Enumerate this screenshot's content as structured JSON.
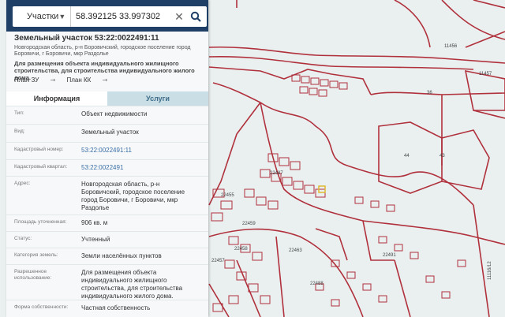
{
  "search": {
    "type_label": "Участки",
    "query": "58.392125 33.997302"
  },
  "parcel": {
    "title": "Земельный участок 53:22:0022491:11",
    "address_sub": "Новгородская область, р-н Боровичский, городское поселение город Боровичи, г Боровичи, мкр Раздолье",
    "purpose": "Для размещения объекта индивидуального жилищного строительства, для строительства индивидуального жилого дома.",
    "plan_links": [
      "План ЗУ",
      "План КК"
    ]
  },
  "tabs": [
    {
      "label": "Информация",
      "active": true
    },
    {
      "label": "Услуги",
      "active": false
    }
  ],
  "info_rows": [
    {
      "label": "Тип:",
      "value": "Объект недвижимости"
    },
    {
      "label": "Вид:",
      "value": "Земельный участок"
    },
    {
      "label": "Кадастровый номер:",
      "value": "53:22:0022491:11",
      "link": true
    },
    {
      "label": "Кадастровый квартал:",
      "value": "53:22:0022491",
      "link": true
    },
    {
      "label": "Адрес:",
      "value": "Новгородская область, р-н Боровичский, городское поселение город Боровичи, г Боровичи, мкр Раздолье"
    },
    {
      "label": "Площадь уточненная:",
      "value": "906 кв. м"
    },
    {
      "label": "Статус:",
      "value": "Учтенный"
    },
    {
      "label": "Категория земель:",
      "value": "Земли населённых пунктов"
    },
    {
      "label": "Разрешенное использование:",
      "value": "Для размещения объекта индивидуального жилищного строительства, для строительства индивидуального жилого дома."
    },
    {
      "label": "Форма собственности:",
      "value": "Частная собственность"
    }
  ],
  "map_labels": [
    "11456",
    "11457",
    "36",
    "44",
    "43",
    "22459",
    "22463",
    "22491",
    "22488",
    "22457",
    "22458",
    "22455",
    "22487",
    "11116/12"
  ],
  "colors": {
    "header": "#1f3f66",
    "tab_inactive": "#c9dee5",
    "link": "#3a6ea5",
    "parcel_line": "#b0303c"
  }
}
